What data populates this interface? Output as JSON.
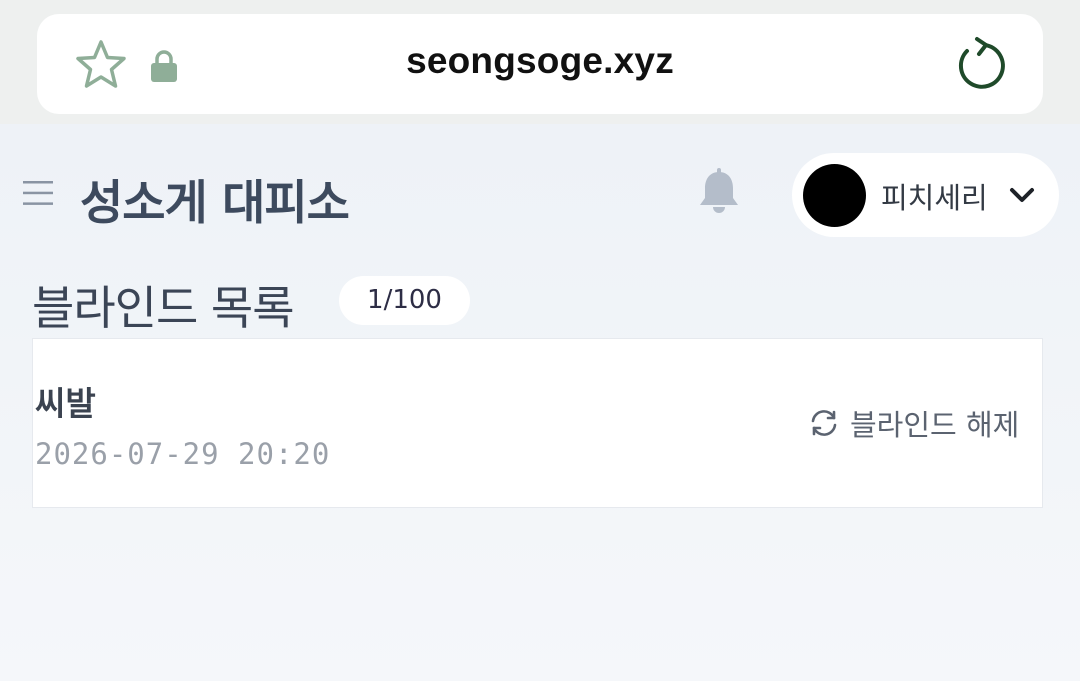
{
  "browser": {
    "url": "seongsoge.xyz",
    "icons": [
      "star-icon",
      "lock-icon",
      "reload-icon"
    ]
  },
  "header": {
    "site_title": "성소게 대피소",
    "user_name": "피치세리",
    "icons": [
      "menu-icon",
      "bell-icon",
      "chevron-down-icon"
    ]
  },
  "section": {
    "title": "블라인드 목록",
    "count": "1/100"
  },
  "blind_items": [
    {
      "word": "씨발",
      "date": "2026-07-29 20:20",
      "action_label": "블라인드 해제"
    }
  ],
  "colors": {
    "title": "#3d4a5e",
    "star_outline": "#8fae98",
    "lock": "#8fae98",
    "reload": "#1f4a2a",
    "bell": "#b4bdca",
    "avatar": "#000000"
  }
}
